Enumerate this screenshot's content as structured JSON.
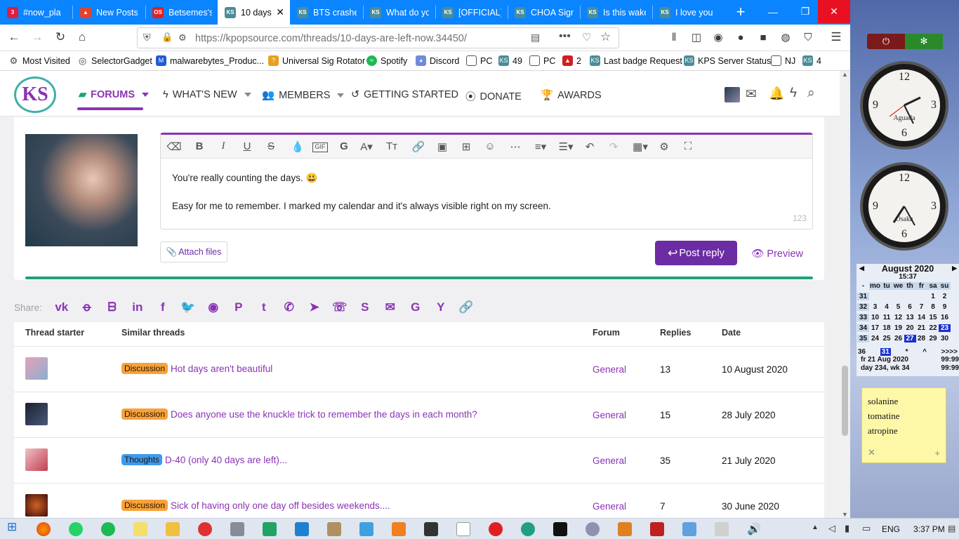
{
  "browser": {
    "tabs": [
      {
        "title": "#now_playi",
        "color": "#e01e3c"
      },
      {
        "title": "New Posts",
        "color": "#e24329"
      },
      {
        "title": "Betsemes's",
        "color": "#e02020"
      },
      {
        "title": "10 days",
        "color": "#4a8c9a"
      },
      {
        "title": "BTS crashed",
        "color": "#4a8c9a"
      },
      {
        "title": "What do yo",
        "color": "#4a8c9a"
      },
      {
        "title": "[OFFICIAL]",
        "color": "#4a8c9a"
      },
      {
        "title": "CHOA Sign",
        "color": "#4a8c9a"
      },
      {
        "title": "Is this wake",
        "color": "#4a8c9a"
      },
      {
        "title": "I love you",
        "color": "#4a8c9a"
      }
    ],
    "url_base": "https://kpopsource.com",
    "url_path": "/threads/10-days-are-left-now.34450/",
    "bookmarks": [
      "Most Visited",
      "SelectorGadget",
      "malwarebytes_Produc...",
      "Universal Sig Rotator",
      "Spotify",
      "Discord",
      "PC",
      "49",
      "PC",
      "2",
      "Last badge Request",
      "KPS Server Status",
      "NJ",
      "4"
    ]
  },
  "site": {
    "logo": "KS",
    "nav": [
      "FORUMS",
      "WHAT'S NEW",
      "MEMBERS",
      "GETTING STARTED",
      "DONATE",
      "AWARDS"
    ]
  },
  "editor": {
    "line1": "You're really counting the days. 😃",
    "line2": "Easy for me to remember. I marked my calendar and it's always visible right on my screen.",
    "char_count": "123",
    "attach_label": "Attach files",
    "post_label": "Post reply",
    "preview_label": "Preview"
  },
  "share": {
    "label": "Share:"
  },
  "similar": {
    "headers": {
      "starter": "Thread starter",
      "title": "Similar threads",
      "forum": "Forum",
      "replies": "Replies",
      "date": "Date"
    },
    "rows": [
      {
        "tag": "Discussion",
        "tag_color": "#f7a23b",
        "title": "Hot days aren't beautiful",
        "forum": "General",
        "replies": "13",
        "date": "10 August 2020"
      },
      {
        "tag": "Discussion",
        "tag_color": "#f7a23b",
        "title": "Does anyone use the knuckle trick to remember the days in each month?",
        "forum": "General",
        "replies": "15",
        "date": "28 July 2020"
      },
      {
        "tag": "Thoughts",
        "tag_color": "#3b9bf0",
        "title": "D-40 (only 40 days are left)...",
        "forum": "General",
        "replies": "35",
        "date": "21 July 2020"
      },
      {
        "tag": "Discussion",
        "tag_color": "#f7a23b",
        "title": "Sick of having only one day off besides weekends....",
        "forum": "General",
        "replies": "7",
        "date": "30 June 2020"
      }
    ]
  },
  "gadgets": {
    "clock1": "Aguada",
    "clock2": "Osaka",
    "cal_month": "August 2020",
    "cal_time": "15:37",
    "cal_days": [
      "mo",
      "tu",
      "we",
      "th",
      "fr",
      "sa",
      "su"
    ],
    "cal_weeks": [
      {
        "wk": "31",
        "days": [
          "",
          "",
          "",
          "",
          "",
          "1",
          "2"
        ]
      },
      {
        "wk": "32",
        "days": [
          "3",
          "4",
          "5",
          "6",
          "7",
          "8",
          "9"
        ]
      },
      {
        "wk": "33",
        "days": [
          "10",
          "11",
          "12",
          "13",
          "14",
          "15",
          "16"
        ]
      },
      {
        "wk": "34",
        "days": [
          "17",
          "18",
          "19",
          "20",
          "21",
          "22",
          "23"
        ]
      },
      {
        "wk": "35",
        "days": [
          "24",
          "25",
          "26",
          "27",
          "28",
          "29",
          "30"
        ]
      },
      {
        "wk": "36",
        "days": [
          "31",
          "",
          "",
          "",
          "",
          "",
          ""
        ]
      }
    ],
    "cal_footer1": "fr 21 Aug 2020",
    "cal_footer2": "day 234, wk 34",
    "cal_val": "99:99",
    "note_lines": [
      "solanine",
      "tomatine",
      "atropine"
    ]
  },
  "taskbar": {
    "lang": "ENG",
    "time": "3:37 PM"
  }
}
